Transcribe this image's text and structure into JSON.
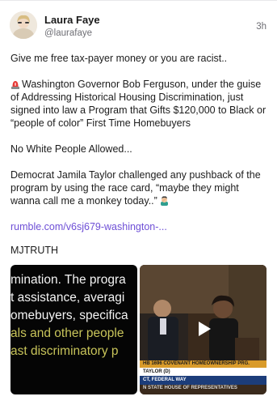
{
  "post": {
    "author": "Laura Faye",
    "handle": "@laurafaye",
    "time": "3h",
    "paragraphs": [
      "Give me free tax-payer money or you are racist..",
      "Washington Governor Bob Ferguson, under the guise of Addressing Historical Housing Discrimination, just signed into law a Program that Gifts $120,000 to Black or “people of color” First Time Homebuyers",
      "No White People Allowed...",
      "Democrat Jamila Taylor challenged any pushback of the program by using the race card, “maybe they might wanna call me a monkey today..”"
    ],
    "link": "rumble.com/v6sj679-washington-...",
    "tag": "MJTRUTH",
    "icons": {
      "paragraph_2_prefix": "police-siren-icon",
      "paragraph_4_suffix": "man-facepalming-icon",
      "video_overlay": "play-icon"
    }
  },
  "media": {
    "left_caption_lines": [
      "mination. The progra",
      "t assistance, averagi",
      "omebuyers, specifica",
      "als and other people",
      "ast discriminatory p"
    ],
    "right_ticker": {
      "top": "HB 1696 COVENANT HOMEOWNERSHIP PRG.",
      "middle": "TAYLOR (D)",
      "bottom": "CT, FEDERAL WAY",
      "sub": "N STATE HOUSE OF REPRESENTATIVES"
    }
  },
  "colors": {
    "link": "#6e4fd6",
    "secondary_text": "#6f6f75",
    "ticker_orange": "#d99b2a",
    "ticker_blue": "#1c3d7a"
  }
}
